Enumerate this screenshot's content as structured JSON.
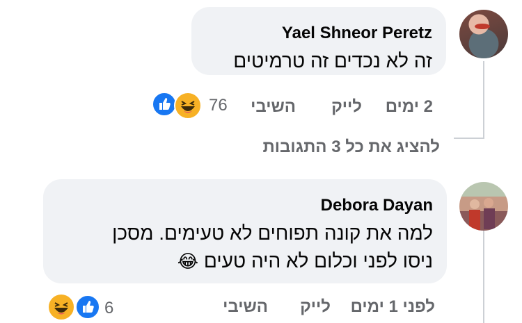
{
  "comments": [
    {
      "author": "Yael Shneor Peretz",
      "lines": [
        "זה לא נכדים זה טרמיטים"
      ],
      "time": "2 ימים",
      "like_label": "לייק",
      "reply_label": "השיבי",
      "reaction_count": "76",
      "reactions": [
        "like-icon",
        "haha-icon"
      ]
    },
    {
      "author": "Debora Dayan",
      "lines": [
        "למה את קונה תפוחים לא טעימים. מסכן",
        "ניסו לפני וכלום לא היה טעים"
      ],
      "emoji": "😂",
      "time": "לפני 1 ימים",
      "like_label": "לייק",
      "reply_label": "השיבי",
      "reaction_count": "6",
      "reactions": [
        "like-icon",
        "haha-icon"
      ]
    }
  ],
  "view_replies": "להציג את כל 3 התגובות",
  "colors": {
    "bubble": "#f0f2f5",
    "meta": "#65676b",
    "like": "#1877f2",
    "haha": "#f7b125"
  }
}
